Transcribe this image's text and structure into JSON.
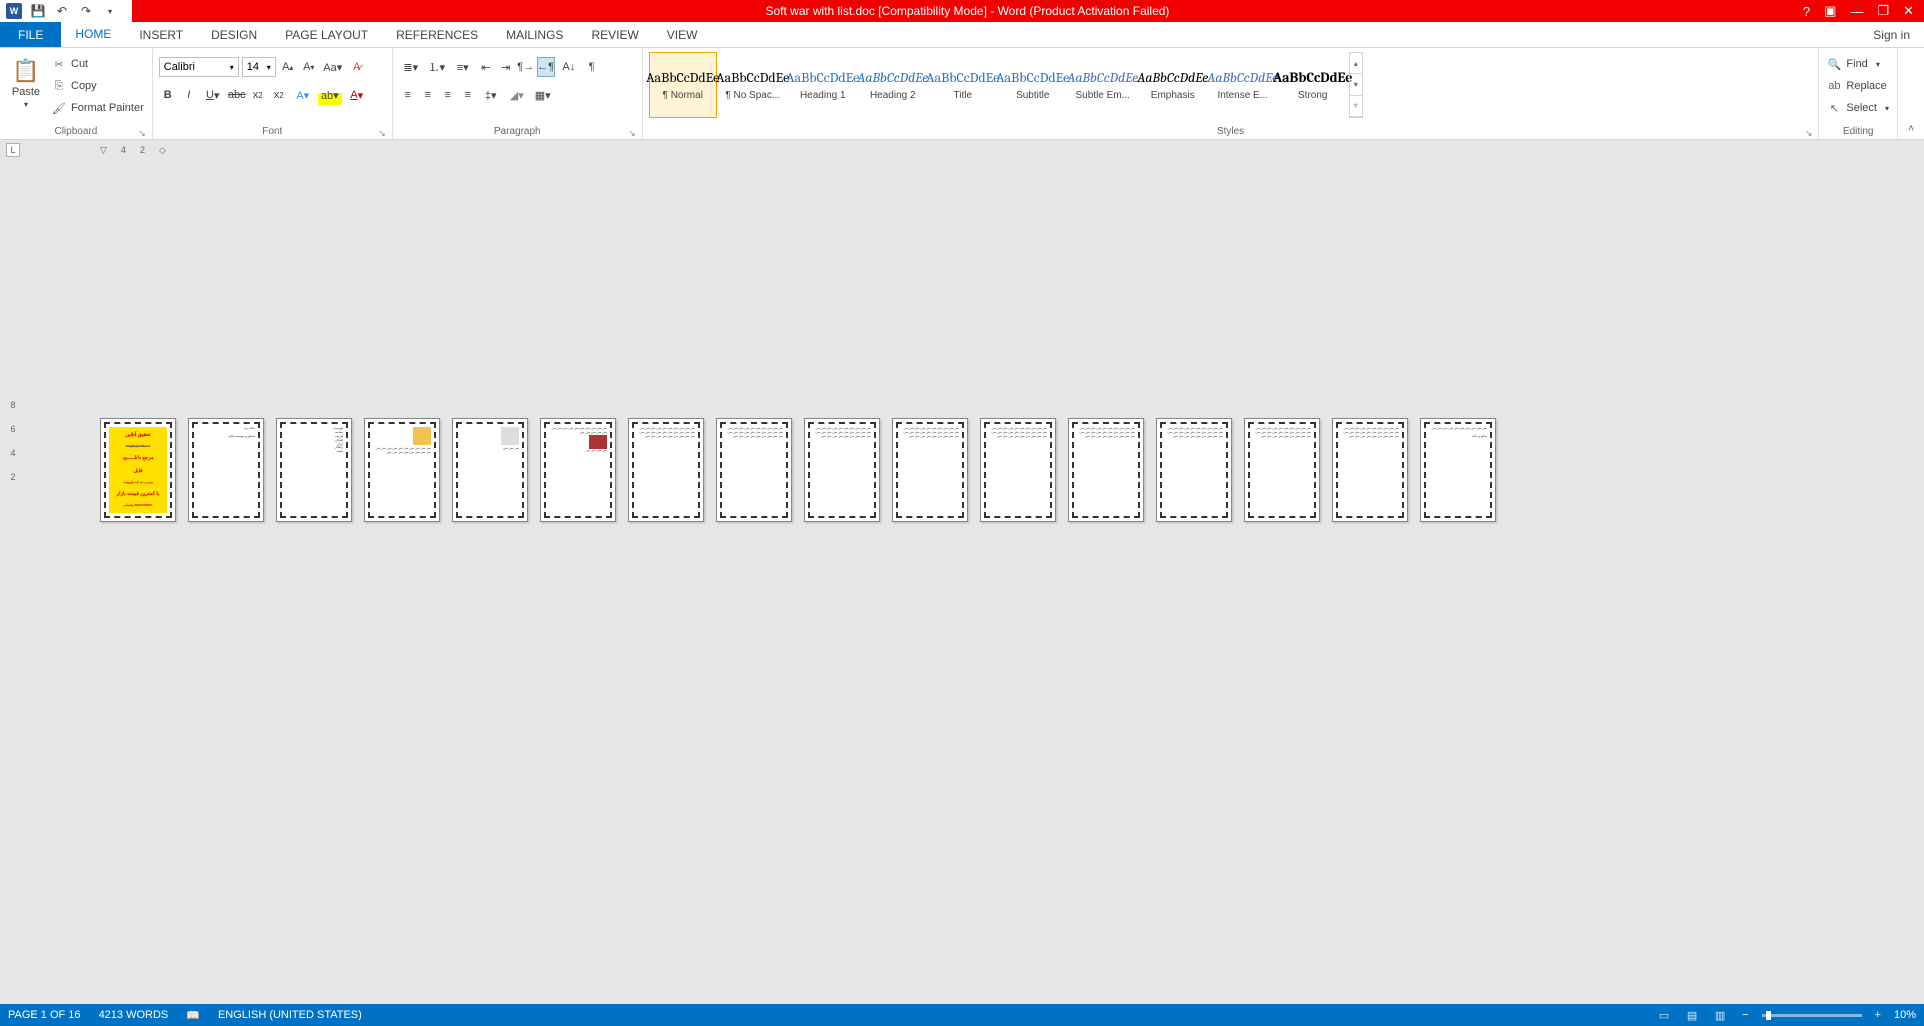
{
  "titlebar": {
    "title": "Soft war with list.doc [Compatibility Mode] - Word (Product Activation Failed)"
  },
  "tabs": {
    "file": "FILE",
    "items": [
      "HOME",
      "INSERT",
      "DESIGN",
      "PAGE LAYOUT",
      "REFERENCES",
      "MAILINGS",
      "REVIEW",
      "VIEW"
    ],
    "active": "HOME",
    "signin": "Sign in"
  },
  "clipboard": {
    "paste": "Paste",
    "cut": "Cut",
    "copy": "Copy",
    "format_painter": "Format Painter",
    "label": "Clipboard"
  },
  "font": {
    "name": "Calibri",
    "size": "14",
    "label": "Font"
  },
  "paragraph": {
    "label": "Paragraph"
  },
  "styles": {
    "label": "Styles",
    "items": [
      {
        "preview": "AaBbCcDdEe",
        "name": "¶ Normal",
        "cls": ""
      },
      {
        "preview": "AaBbCcDdEe",
        "name": "¶ No Spac...",
        "cls": ""
      },
      {
        "preview": "AaBbCcDdEe",
        "name": "Heading 1",
        "cls": "blue"
      },
      {
        "preview": "AaBbCcDdEe",
        "name": "Heading 2",
        "cls": "blue italic"
      },
      {
        "preview": "AaBbCcDdEe",
        "name": "Title",
        "cls": "blue"
      },
      {
        "preview": "AaBbCcDdEe",
        "name": "Subtitle",
        "cls": "blue"
      },
      {
        "preview": "AaBbCcDdEe",
        "name": "Subtle Em...",
        "cls": "italic accent"
      },
      {
        "preview": "AaBbCcDdEe",
        "name": "Emphasis",
        "cls": "italic"
      },
      {
        "preview": "AaBbCcDdEe",
        "name": "Intense E...",
        "cls": "intense"
      },
      {
        "preview": "AaBbCcDdEe",
        "name": "Strong",
        "cls": "strong"
      }
    ]
  },
  "editing": {
    "find": "Find",
    "replace": "Replace",
    "select": "Select",
    "label": "Editing"
  },
  "ruler": {
    "marks": [
      "4",
      "2"
    ]
  },
  "ruler_v": {
    "marks": [
      "2",
      "4",
      "6",
      "8"
    ]
  },
  "status": {
    "page": "PAGE 1 OF 16",
    "words": "4213 WORDS",
    "language": "ENGLISH (UNITED STATES)",
    "zoom": "10%"
  },
  "cover": {
    "l1": "تحقیق آنلاین",
    "l2": "Tahghighonline.ir",
    "l3": "مرجع دانلـــــود",
    "l4": "فایل",
    "l5": "ورد،پی دی اف،پاورپونت",
    "l6": "با کمترین قیمت بازار",
    "l7": "09981366824 واتساپ"
  }
}
